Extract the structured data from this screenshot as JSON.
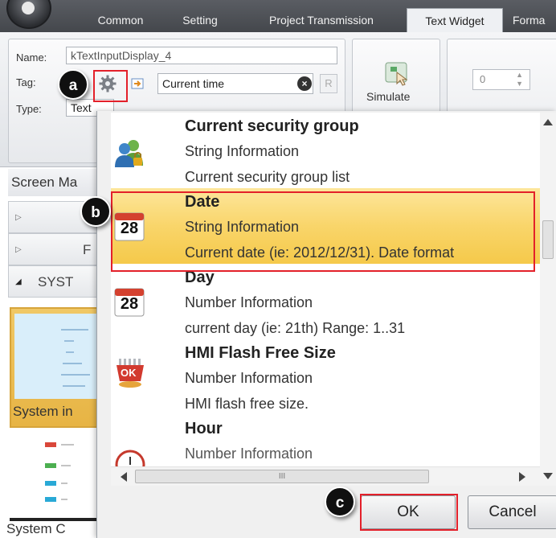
{
  "ribbon": {
    "tabs": [
      {
        "label": "Common"
      },
      {
        "label": "Setting"
      },
      {
        "label": "Project Transmission"
      },
      {
        "label": "Text Widget"
      },
      {
        "label": "Forma"
      }
    ],
    "active_tab": "Text Widget",
    "name_label": "Name:",
    "name_value": "kTextInputDisplay_4",
    "tag_label": "Tag:",
    "tag_value": "Current time",
    "r_button": "R",
    "type_label": "Type:",
    "type_value": "Text",
    "simulate_label": "Simulate",
    "spinner_value": "0"
  },
  "left_panel": {
    "screen_manager": "Screen Ma",
    "rows": [
      {
        "label": ""
      },
      {
        "label": "F"
      },
      {
        "label": "SYST"
      }
    ],
    "thumb1_caption": "System in",
    "thumb2_caption": "System C"
  },
  "dropdown": {
    "items": [
      {
        "title": "Current security group",
        "kind": "String Information",
        "desc": "Current security group list",
        "icon": "security-group-icon"
      },
      {
        "title": "Date",
        "kind": "String Information",
        "desc": "Current date (ie: 2012/12/31). Date format",
        "icon": "calendar-icon",
        "selected": true,
        "calendar_day": "28"
      },
      {
        "title": "Day",
        "kind": "Number Information",
        "desc": "current day (ie: 21th) Range: 1..31",
        "icon": "calendar-icon",
        "calendar_day": "28"
      },
      {
        "title": "HMI Flash Free Size",
        "kind": "Number Information",
        "desc": "HMI flash free size.",
        "icon": "flash-ok-icon",
        "ok_text": "OK"
      },
      {
        "title": "Hour",
        "kind": "Number Information",
        "desc": "",
        "icon": "clock-icon"
      }
    ],
    "hscroll_grip": "III",
    "ok_label": "OK",
    "cancel_label": "Cancel"
  },
  "callouts": {
    "a": "a",
    "b": "b",
    "c": "c"
  },
  "colors": {
    "selected_row": "#f9d56a",
    "callout_red": "#e3202a",
    "badge_bg": "#101010"
  }
}
